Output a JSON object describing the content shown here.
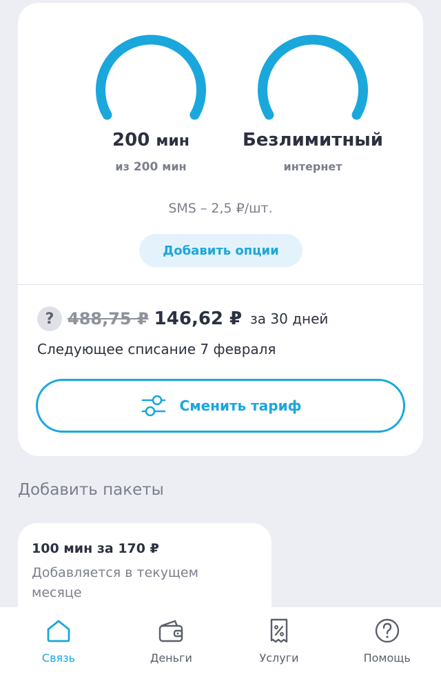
{
  "gauges": {
    "minutes": {
      "value": "200",
      "unit": "мин",
      "sub_prefix": "из",
      "sub_value": "200",
      "sub_unit": "мин",
      "fill_fraction": 1.0
    },
    "internet": {
      "main": "Безлимитный",
      "sub": "интернет",
      "fill_fraction": 1.0
    }
  },
  "sms_text": "SMS – 2,5 ₽/шт.",
  "add_options_label": "Добавить опции",
  "price": {
    "help_glyph": "?",
    "old_price": "488,75 ₽",
    "new_price": "146,62 ₽",
    "period": "за 30 дней"
  },
  "next_charge": "Следующее списание 7 февраля",
  "change_tariff_label": "Сменить тариф",
  "packages": {
    "section_title": "Добавить пакеты",
    "items": [
      {
        "title": "100 мин за 170 ₽",
        "description": "Добавляется в текущем месяце"
      }
    ]
  },
  "bottom_nav": {
    "items": [
      {
        "label": "Связь",
        "icon": "home-icon",
        "active": true
      },
      {
        "label": "Деньги",
        "icon": "wallet-icon",
        "active": false
      },
      {
        "label": "Услуги",
        "icon": "receipt-percent-icon",
        "active": false
      },
      {
        "label": "Помощь",
        "icon": "help-circle-icon",
        "active": false
      }
    ]
  },
  "colors": {
    "accent": "#1aa7dc",
    "background": "#eceef4",
    "card": "#ffffff",
    "text_primary": "#2c3140",
    "text_secondary": "#7b7f8c"
  }
}
